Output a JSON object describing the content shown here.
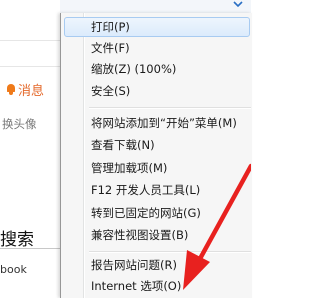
{
  "background": {
    "message_label": "消息",
    "swap_avatar_text": "换头像",
    "search_text": "搜索",
    "book_text": "book"
  },
  "menu": {
    "items": [
      {
        "label": "打印(P)"
      },
      {
        "label": "文件(F)"
      },
      {
        "label": "缩放(Z) (100%)"
      },
      {
        "label": "安全(S)"
      },
      {
        "label": "将网站添加到“开始”菜单(M)"
      },
      {
        "label": "查看下载(N)"
      },
      {
        "label": "管理加载项(M)"
      },
      {
        "label": "F12 开发人员工具(L)"
      },
      {
        "label": "转到已固定的网站(G)"
      },
      {
        "label": "兼容性视图设置(B)"
      },
      {
        "label": "报告网站问题(R)"
      },
      {
        "label": "Internet 选项(O)"
      }
    ]
  },
  "colors": {
    "accent_orange": "#e4692b",
    "highlight_border": "#a8cbf1",
    "arrow_red": "#e8211f"
  }
}
